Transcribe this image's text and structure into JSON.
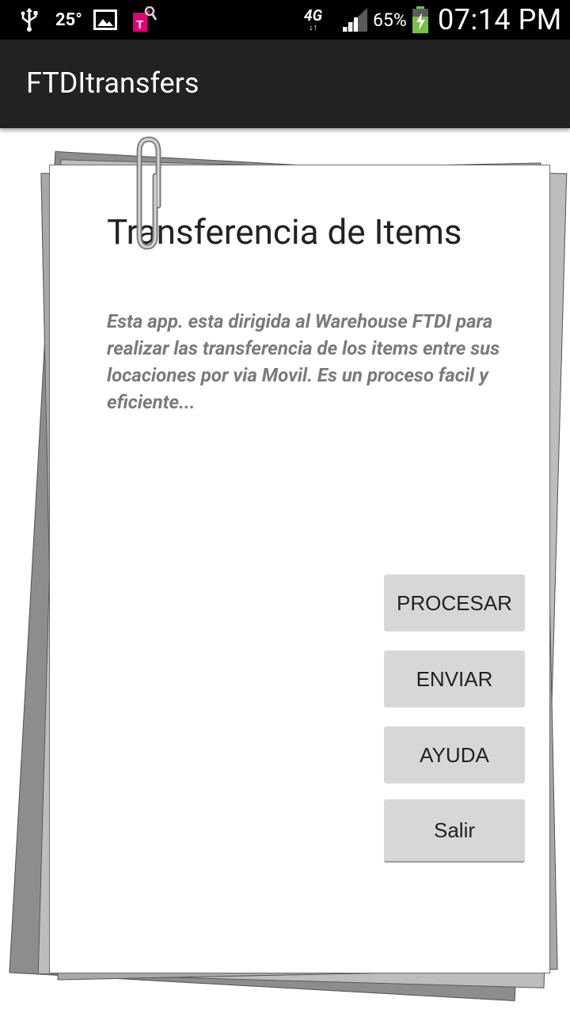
{
  "status_bar": {
    "icons": [
      "usb-icon",
      "gallery-icon",
      "t-mobile-icon",
      "signal-icon",
      "battery-charging-icon"
    ],
    "temperature": "25°",
    "network": "4G",
    "battery": "65%",
    "time": "07:14 PM"
  },
  "action_bar": {
    "title": "FTDItransfers"
  },
  "card": {
    "title": "Transferencia de Items",
    "description": "Esta app. esta dirigida al Warehouse FTDI para realizar las transferencia de los items entre sus locaciones por via Movil. Es un proceso facil y eficiente..."
  },
  "buttons": {
    "procesar": "PROCESAR",
    "enviar": "ENVIAR",
    "ayuda": "AYUDA",
    "salir": "Salir"
  },
  "colors": {
    "status_bar_bg": "#000000",
    "action_bar_bg": "#222222",
    "button_bg": "#d6d7d7",
    "description_text": "#7a7a7a",
    "tmobile_magenta": "#e20074",
    "battery_green": "#7ac143"
  }
}
